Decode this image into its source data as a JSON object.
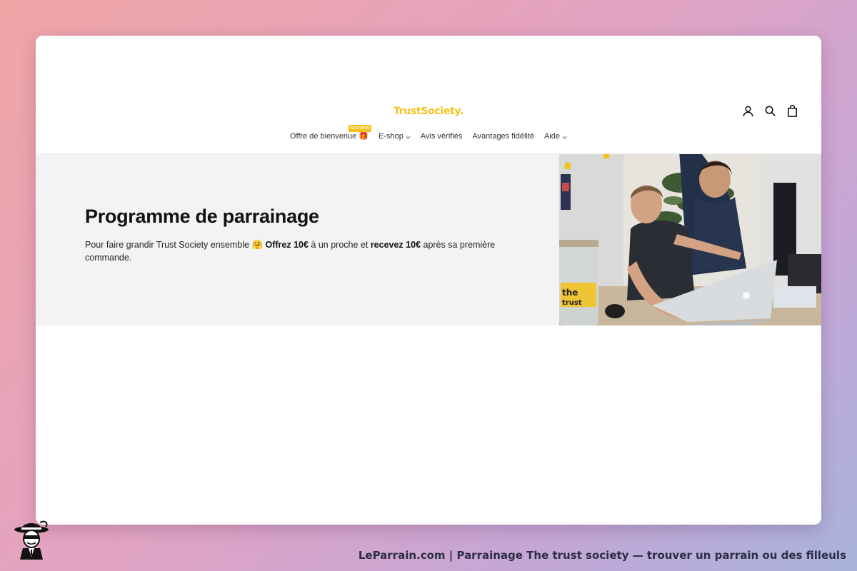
{
  "brand": {
    "logo_text": "TrustSociety.",
    "accent": "#f4c21a"
  },
  "header": {
    "icons": [
      "account-icon",
      "search-icon",
      "cart-icon"
    ]
  },
  "nav": {
    "items": [
      {
        "label": "Offre de bienvenue 🎁",
        "badge": "Nouveau"
      },
      {
        "label": "E-shop",
        "dropdown": true
      },
      {
        "label": "Avis vérifiés"
      },
      {
        "label": "Avantages fidélité"
      },
      {
        "label": "Aide",
        "dropdown": true
      }
    ]
  },
  "hero": {
    "title": "Programme de parrainage",
    "text_before": "Pour faire grandir Trust Society ensemble 🤗 ",
    "bold_1": "Offrez 10€",
    "text_mid": " à un proche et ",
    "bold_2": "recevez 10€",
    "text_after": " après sa première commande.",
    "image_jar_text": "the trust society"
  },
  "footer": {
    "caption": "LeParrain.com | Parrainage The trust society — trouver un parrain ou des filleuls"
  }
}
